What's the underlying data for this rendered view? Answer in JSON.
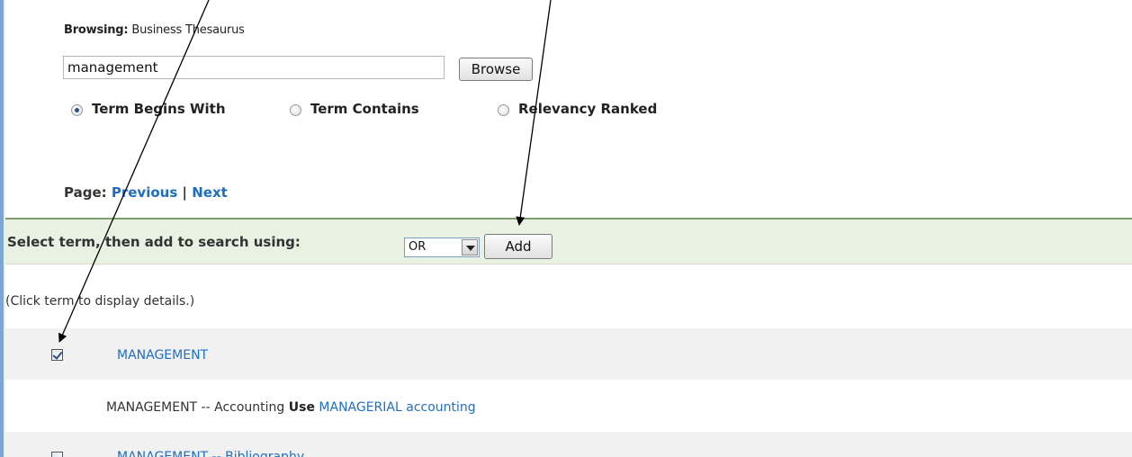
{
  "browse": {
    "heading_label": "Browsing:",
    "heading_value": "Business Thesaurus",
    "search_value": "management",
    "browse_button": "Browse",
    "options": [
      {
        "label": "Term Begins With",
        "selected": true
      },
      {
        "label": "Term Contains",
        "selected": false
      },
      {
        "label": "Relevancy Ranked",
        "selected": false
      }
    ]
  },
  "pager": {
    "label": "Page:",
    "previous": "Previous",
    "separator": "|",
    "next": "Next"
  },
  "select_bar": {
    "text": "Select term, then add to search using:",
    "operator": "OR",
    "add_button": "Add"
  },
  "hint": "(Click term to display details.)",
  "results": [
    {
      "term": "MANAGEMENT",
      "checked": true
    },
    {
      "prefix": "MANAGEMENT -- Accounting",
      "use_label": "Use",
      "use_term": "MANAGERIAL accounting"
    },
    {
      "term": "MANAGEMENT -- Bibliography",
      "checked": false
    }
  ],
  "colors": {
    "link": "#1f6ec4",
    "bar_bg": "#e9f1e3",
    "bar_border": "#7f9d6e",
    "row_alt": "#f1f1f1"
  }
}
